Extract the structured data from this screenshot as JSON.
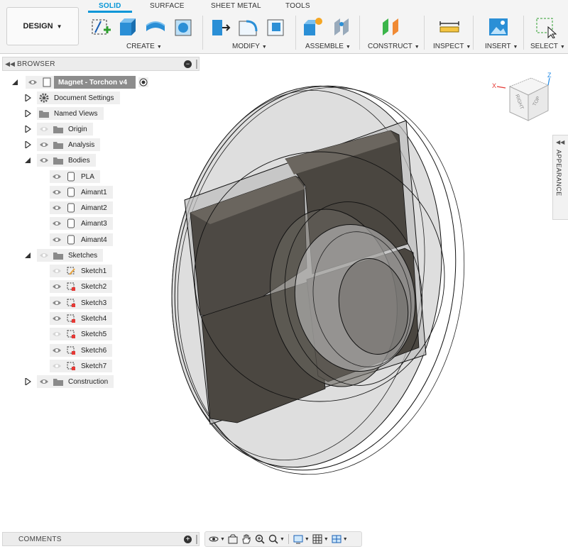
{
  "workspace": {
    "label": "DESIGN"
  },
  "tabs": [
    "SOLID",
    "SURFACE",
    "SHEET METAL",
    "TOOLS"
  ],
  "groups": [
    "CREATE",
    "MODIFY",
    "ASSEMBLE",
    "CONSTRUCT",
    "INSPECT",
    "INSERT",
    "SELECT"
  ],
  "browser": {
    "title": "BROWSER",
    "root": "Magnet - Torchon v4",
    "items": [
      "Document Settings",
      "Named Views",
      "Origin",
      "Analysis",
      "Bodies",
      "PLA",
      "Aimant1",
      "Aimant2",
      "Aimant3",
      "Aimant4",
      "Sketches",
      "Sketch1",
      "Sketch2",
      "Sketch3",
      "Sketch4",
      "Sketch5",
      "Sketch6",
      "Sketch7",
      "Construction"
    ]
  },
  "viewcube": {
    "right": "RIGHT",
    "top": "TOP",
    "axis_x": "X",
    "axis_z": "Z"
  },
  "appearance": {
    "label": "APPEARANCE"
  },
  "comments": {
    "title": "COMMENTS"
  },
  "colors": {
    "accent": "#0696d7",
    "magnet": "#4a4640",
    "disc": "#d6d6d6"
  }
}
